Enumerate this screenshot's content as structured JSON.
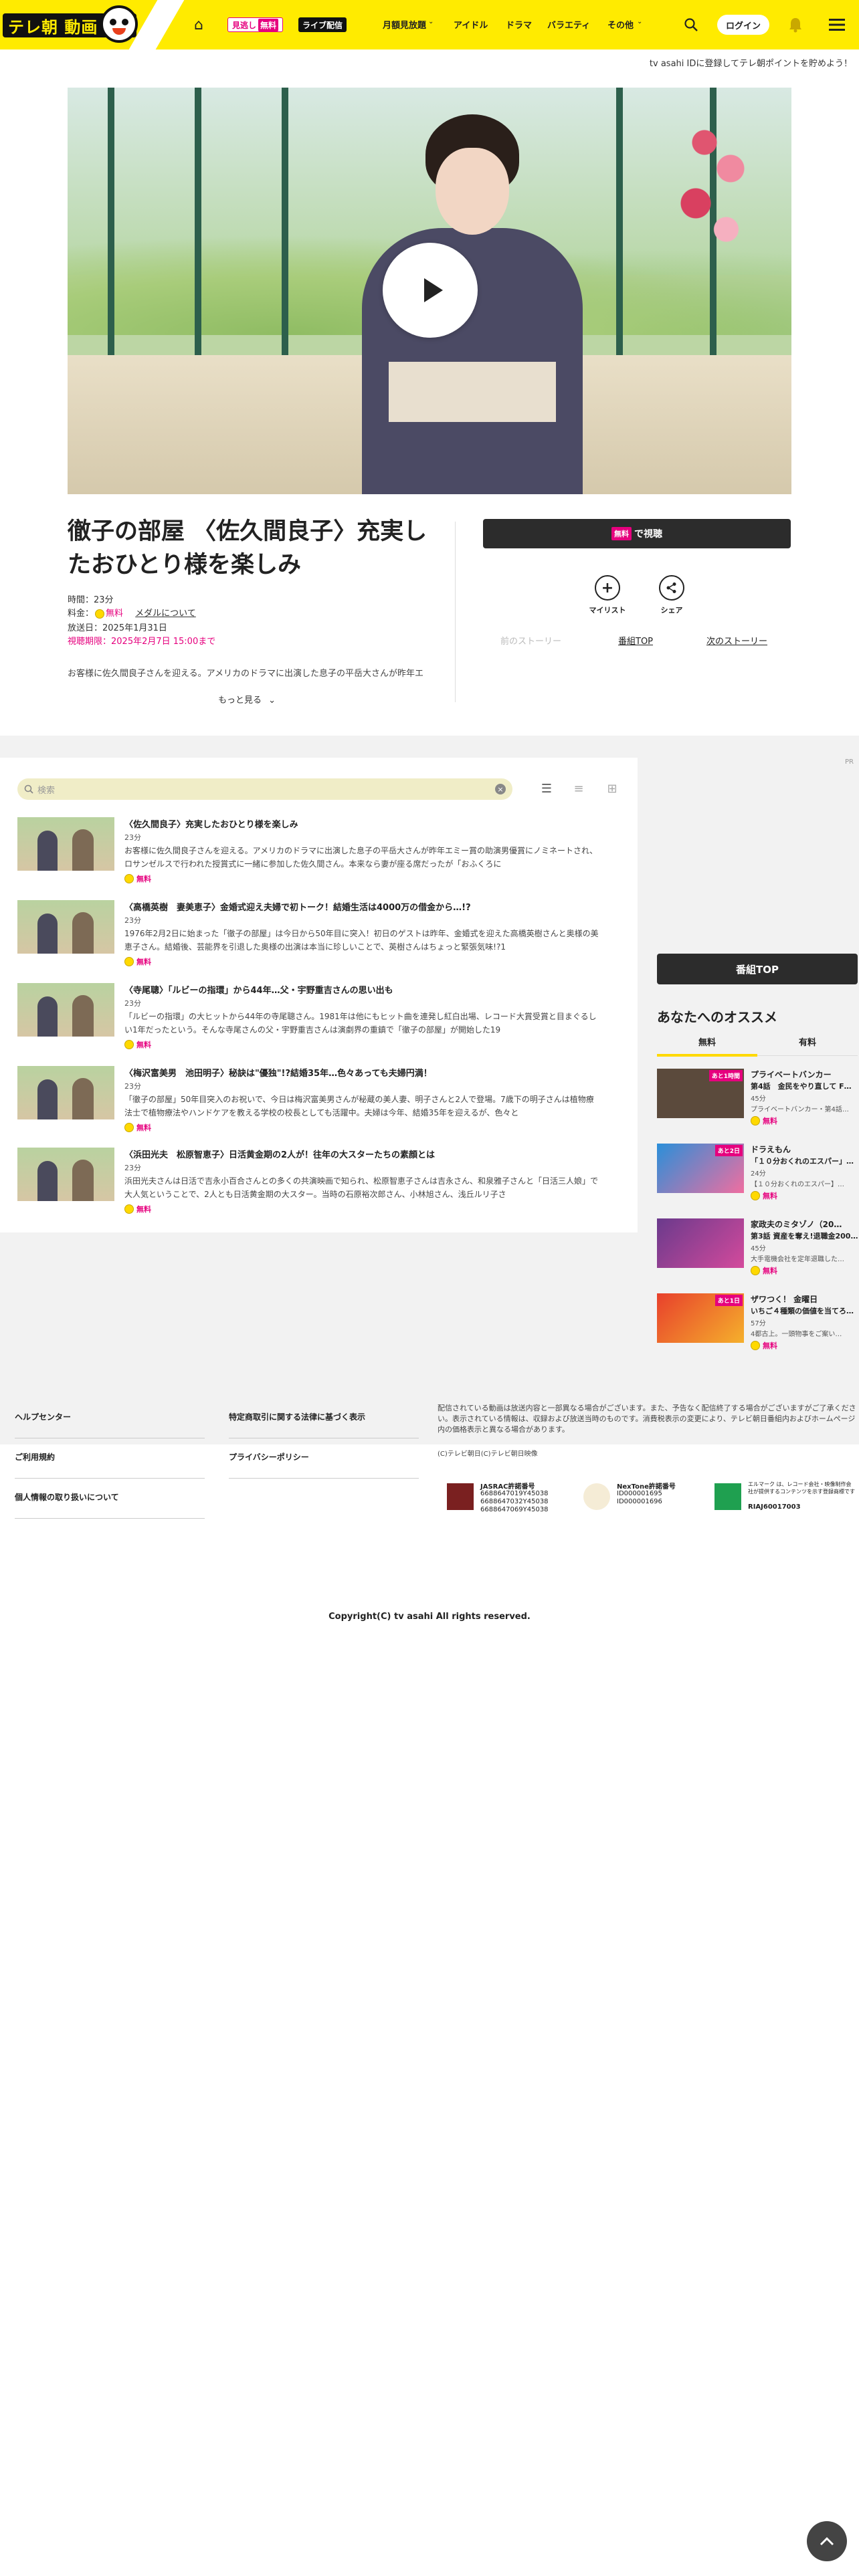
{
  "header": {
    "logo_text": "テレ朝 動画",
    "mitai_label": "見逃し",
    "free_label": "無料",
    "live_label": "ライブ配信",
    "nav_items": [
      "月額見放題",
      "アイドル",
      "ドラマ",
      "バラエティ",
      "その他"
    ],
    "login_label": "ログイン"
  },
  "promo_text": "tv asahi IDに登録してテレ朝ポイントを貯めよう！",
  "episode": {
    "title": "徹子の部屋 〈佐久間良子〉充実したおひとり様を楽しみ",
    "duration": "時間：23分",
    "price_label": "料金：",
    "price_value": "無料",
    "medal_link": "メダルについて",
    "aired": "放送日：2025年1月31日",
    "deadline": "視聴期限：2025年2月7日 15:00まで",
    "description": "お客様に佐久間良子さんを迎える。アメリカのドラマに出演した息子の平岳大さんが昨年エ",
    "more_label": "もっと見る",
    "watch_free": "無料",
    "watch_label": "で視聴",
    "mylist_label": "マイリスト",
    "share_label": "シェア",
    "prev_story": "前のストーリー",
    "program_top": "番組TOP",
    "next_story": "次のストーリー"
  },
  "ad_label": "PR",
  "search": {
    "placeholder": "検索"
  },
  "episode_list": [
    {
      "title": "〈佐久間良子〉充実したおひとり様を楽しみ",
      "duration": "23分",
      "description": "お客様に佐久間良子さんを迎える。アメリカのドラマに出演した息子の平岳大さんが昨年エミー賞の助演男優賞にノミネートされ、ロサンゼルスで行われた授賞式に一緒に参加した佐久間さん。本来なら妻が座る席だったが「おふくろに",
      "free": "無料"
    },
    {
      "title": "〈高橋英樹　妻美恵子〉金婚式迎え夫婦で初トーク！結婚生活は4000万の借金から…!?",
      "duration": "23分",
      "description": "1976年2月2日に始まった「徹子の部屋」は今日から50年目に突入！初日のゲストは昨年、金婚式を迎えた高橋英樹さんと奥様の美恵子さん。結婚後、芸能界を引退した奥様の出演は本当に珍しいことで、英樹さんはちょっと緊張気味!?1",
      "free": "無料"
    },
    {
      "title": "〈寺尾聰〉「ルビーの指環」から44年…父・宇野重吉さんの思い出も",
      "duration": "23分",
      "description": "「ルビーの指環」の大ヒットから44年の寺尾聰さん。1981年は他にもヒット曲を連発し紅白出場、レコード大賞受賞と目まぐるしい1年だったという。そんな寺尾さんの父・宇野重吉さんは演劇界の重鎮で「徹子の部屋」が開始した19",
      "free": "無料"
    },
    {
      "title": "〈梅沢富美男　池田明子〉秘訣は\"優独\"!?結婚35年…色々あっても夫婦円満！",
      "duration": "23分",
      "description": "「徹子の部屋」50年目突入のお祝いで、今日は梅沢富美男さんが秘蔵の美人妻、明子さんと2人で登場。7歳下の明子さんは植物療法士で植物療法やハンドケアを教える学校の校長としても活躍中。夫婦は今年、結婚35年を迎えるが、色々と",
      "free": "無料"
    },
    {
      "title": "〈浜田光夫　松原智恵子〉日活黄金期の2人が！往年の大スターたちの素顔とは",
      "duration": "23分",
      "description": "浜田光夫さんは日活で吉永小百合さんとの多くの共演映画で知られ、松原智恵子さんは吉永さん、和泉雅子さんと「日活三人娘」で大人気ということで、2人とも日活黄金期の大スター。当時の石原裕次郎さん、小林旭さん、浅丘ルリ子さ",
      "free": "無料"
    }
  ],
  "sidebar": {
    "program_top": "番組TOP",
    "title": "あなたへのオススメ",
    "tab_free": "無料",
    "tab_paid": "有料",
    "items": [
      {
        "badge": "あと1時間",
        "title": "プライベートバンカー",
        "subtitle": "第4話　金民をやり直して F…",
        "duration": "45分",
        "desc": "プライベートバンカー・第4話…",
        "free": "無料",
        "thumb_color": "#5b4a3c"
      },
      {
        "badge": "あと2日",
        "title": "ドラえもん",
        "subtitle": "「１０分おくれのエスパー」…",
        "duration": "24分",
        "desc": "【１０分おくれのエスパー】…",
        "free": "無料",
        "thumb_color": "#e94a8c"
      },
      {
        "badge": "",
        "title": "家政夫のミタゾノ（20…",
        "subtitle": "第3話 資産を奪え!退職金200…",
        "duration": "45分",
        "desc": "大手電機会社を定年退職した…",
        "free": "無料",
        "thumb_color": "#b34a8c"
      },
      {
        "badge": "あと1日",
        "title": "ザワつく！ 金曜日",
        "subtitle": "いちご４種類の価値を当てろ…",
        "duration": "57分",
        "desc": "4都古上。一頭物事をご案い…",
        "free": "無料",
        "thumb_color": "#e8402c"
      }
    ]
  },
  "footer": {
    "links_col1": [
      "ヘルプセンター",
      "ご利用規約",
      "個人情報の取り扱いについて"
    ],
    "links_col2": [
      "特定商取引に関する法律に基づく表示",
      "プライバシーポリシー"
    ],
    "note": "配信されている動画は放送内容と一部異なる場合がございます。また、予告なく配信終了する場合がございますがご了承ください。表示されている情報は、収録および放送当時のものです。消費税表示の変更により、テレビ朝日番組内およびホームページ内の価格表示と異なる場合があります。",
    "copy2": "(C)テレビ朝日(C)テレビ朝日映像",
    "jasrac_title": "JASRAC許諾番号",
    "jasrac_lines": [
      "6688647019Y45038",
      "6688647032Y45038",
      "6688647069Y45038"
    ],
    "nextone_title": "NexTone許諾番号",
    "nextone_lines": [
      "ID000001695",
      "ID000001696"
    ],
    "riaj_title": "エルマーク は、レコード会社・映像制作会社が提供するコンテンツを示す登録商標です",
    "riaj_line": "RIAJ60017003",
    "copyright": "Copyright(C) tv asahi All rights reserved."
  },
  "colors": {
    "brand_yellow": "#ffeb00",
    "free_pink": "#e6007e",
    "dark_button": "#2c2c2c"
  }
}
